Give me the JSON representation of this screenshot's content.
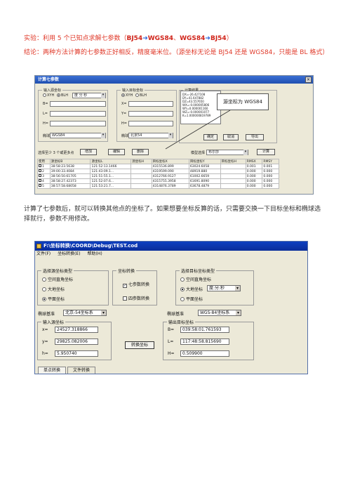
{
  "heading": {
    "prefix": "实验：利用 5 个已知点求解七参数（",
    "bj54": "BJ54",
    "wgs84": "WGS84",
    "sep": "、",
    "wgs84b": "WGS84",
    "bj54b": "BJ54",
    "suffix": "）",
    "arrow": "➔"
  },
  "conclusion": "结论：两种方法计算的七参数正好相反，精度毫米位。（源坐标无论是 BJ54 还是 WGS84，只能是 BL 格式）",
  "note": "计算了七参数后，就可以转换其他点的坐标了。如果想要坐标反算的话，只需要交换一下目标坐标和椭球选择就行，参数不用修改。",
  "win1": {
    "title": "计算七参数",
    "close": "×",
    "src_group": "输入源坐标",
    "src_xyh": "XYH",
    "src_blh": "BLH",
    "src_fmt": "度 分 秒",
    "src_b": "B=",
    "src_l": "L=",
    "src_h": "H=",
    "src_ellipsoid_label": "椭球",
    "src_ellipsoid": "WGS84",
    "dst_group": "输入目标坐标",
    "dst_xyh": "XYH",
    "dst_blh": "BLH",
    "dst_x": "X=",
    "dst_y": "Y=",
    "dst_h": "H=",
    "dst_ellipsoid_label": "椭球",
    "dst_ellipsoid": "北京54",
    "result_group": "计算结果",
    "result_lines": [
      "DX=-26.427108",
      "DY=41.647882",
      "DZ=43.557650",
      "WX=-0.000005806",
      "WY=0.000001160",
      "WZ=-0.000001077",
      "K=1.000000819789"
    ],
    "callout": "源坐标为 WGS84",
    "btn_ok": "确定",
    "btn_cancel": "取消",
    "btn_export": "导出",
    "pick_label": "选择至少 3 个或更多点",
    "btn_add": "增加",
    "btn_edit": "编辑",
    "btn_delete": "删除",
    "model_label": "模型选择",
    "model": "布尔莎",
    "btn_calc": "计算",
    "columns": [
      "使用",
      "源坐标B",
      "源坐标L",
      "源坐标H",
      "目标坐标X",
      "目标坐标Y",
      "目标坐标H",
      "RMSX",
      "RMSY"
    ],
    "rows": [
      [
        "1",
        "38:58:23.5638",
        "121:52:13.1466",
        "",
        "4315536.899",
        "63024.6058",
        "",
        "0.001",
        "0.001"
      ],
      [
        "2",
        "39:00:33.4084",
        "121:43:09.1...",
        "",
        "4319599.090",
        "48919.880",
        "",
        "0.000",
        "0.000"
      ],
      [
        "3",
        "38:56:50.61705",
        "121:51:55.1...",
        "",
        "4312766.9127",
        "61002.6659",
        "",
        "0.000",
        "0.000"
      ],
      [
        "4",
        "38:58:27.42373",
        "121:52:07.6...",
        "",
        "4315755.3958",
        "61691.8090",
        "",
        "0.000",
        "0.000"
      ],
      [
        "5",
        "38:57:58.68058",
        "121:53:21.7...",
        "",
        "4314876.3789",
        "63678.4879",
        "",
        "0.000",
        "0.000"
      ]
    ]
  },
  "win2": {
    "title": "F:\\坐标转换\\COORD\\Debug\\TEST.cod",
    "menu": [
      "文件(F)",
      "坐标转换(E)",
      "帮助(H)"
    ],
    "src_type_group": "选择源坐标类型",
    "src_opt1": "空间直角坐标",
    "src_opt2": "大地坐标",
    "src_opt3": "平面坐标",
    "conv_group": "坐标转换",
    "conv_opt1": "七参数转换",
    "conv_opt2": "四参数转换",
    "dst_type_group": "选择目标坐标类型",
    "dst_opt1": "空间直角坐标",
    "dst_opt2": "大地坐标",
    "dst_fmt": "度:分:秒",
    "dst_opt3": "平面坐标",
    "src_datum_label": "椭球基准",
    "src_datum": "北京-54坐标系",
    "dst_datum_label": "椭球基准",
    "dst_datum": "WGS-84坐标系",
    "in_group": "输入源坐标",
    "x_lbl": "x=",
    "x_val": "24527.318866",
    "y_lbl": "y=",
    "y_val": "29825.082006",
    "h_lbl": "h=",
    "h_val": "5.950740",
    "btn_convert": "转换坐标",
    "out_group": "输出目标坐标",
    "b_lbl": "B=",
    "b_val": "039:58:01.761593",
    "l_lbl": "L=",
    "l_val": "117:48:58.815690",
    "h2_lbl": "H=",
    "h2_val": "0.509900",
    "tab1": "单点转换",
    "tab2": "文件转换"
  }
}
